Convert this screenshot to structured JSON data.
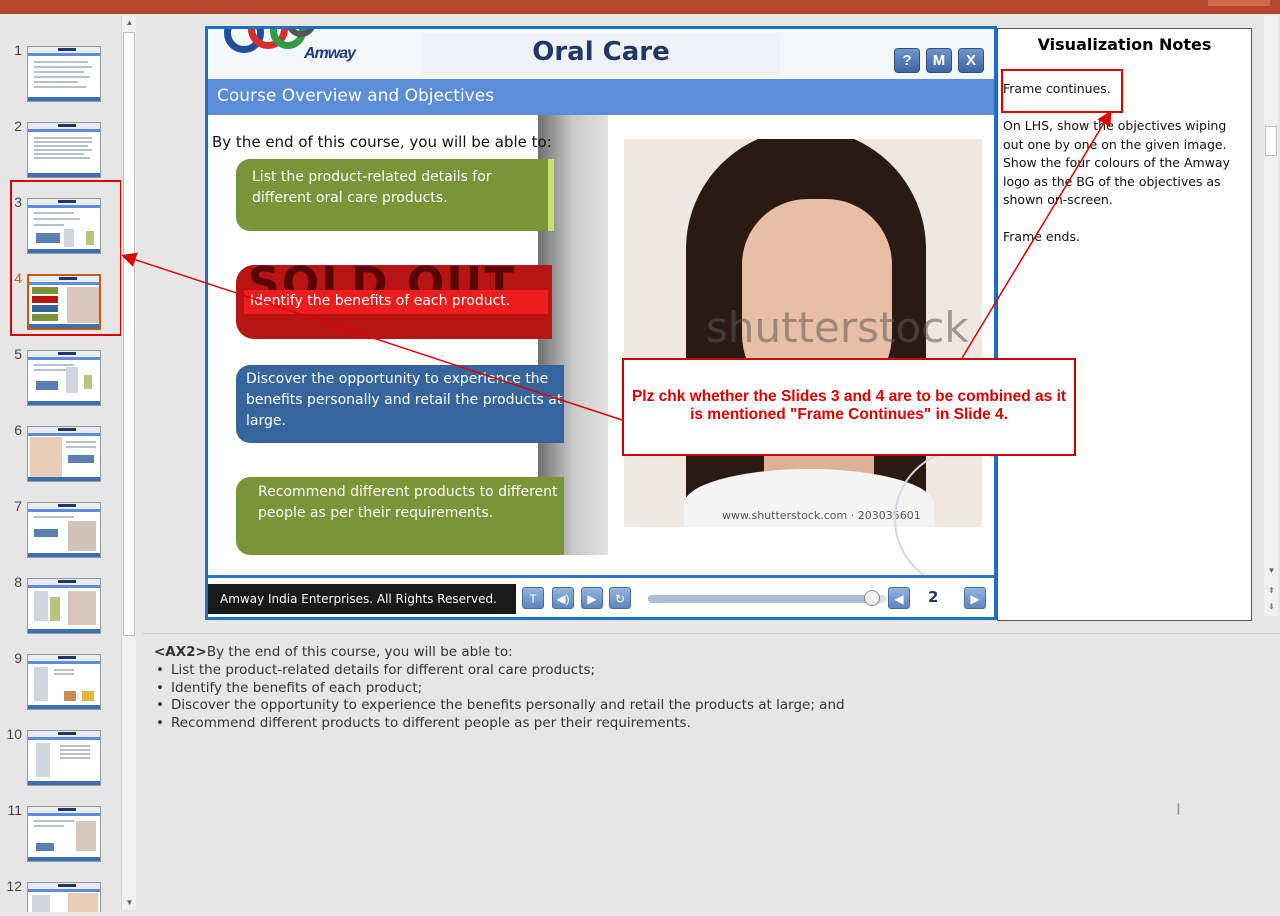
{
  "thumbnails": [
    {
      "num": "1"
    },
    {
      "num": "2"
    },
    {
      "num": "3"
    },
    {
      "num": "4"
    },
    {
      "num": "5"
    },
    {
      "num": "6"
    },
    {
      "num": "7"
    },
    {
      "num": "8"
    },
    {
      "num": "9"
    },
    {
      "num": "10"
    },
    {
      "num": "11"
    },
    {
      "num": "12"
    }
  ],
  "active_slide": "4",
  "slide": {
    "title": "Oral Care",
    "brand": "Amway",
    "header_buttons": [
      "?",
      "M",
      "X"
    ],
    "section_title": "Course Overview and Objectives",
    "intro": "By the end of this course, you will be able to:",
    "objectives": [
      "List the product-related details for different oral care products.",
      "Identify the benefits of each product.",
      "Discover the opportunity to experience the benefits personally and retail the products at large.",
      "Recommend different products to different people as per their requirements."
    ],
    "stamp_text": "SOLD OUT",
    "watermark": "shutterstock",
    "photo_caption": "www.shutterstock.com · 203035601",
    "copyright": "Amway India Enterprises. All Rights Reserved.",
    "footer_buttons": [
      "T",
      "◀)",
      "▶",
      "↻"
    ],
    "page_number": "2",
    "progress": 0.94
  },
  "notes": {
    "title": "Visualization Notes",
    "paragraphs": [
      "Frame continues.",
      "On LHS, show the objectives wiping out one by one on the given image. Show the four colours of the Amway logo as the BG of the objectives as shown on-screen.",
      "Frame ends."
    ]
  },
  "comment": "Plz chk whether the Slides 3 and 4 are to be combined as it is mentioned \"Frame Continues\" in Slide 4.",
  "speaker_notes": {
    "tag": "<AX2>",
    "intro": "By the end of this course, you will be able to:",
    "bullets": [
      "List the product-related details for different oral care products;",
      "Identify the benefits of each product;",
      "Discover the opportunity to experience the benefits personally and retail the products at large; and",
      "Recommend different products to different people as per their requirements."
    ]
  },
  "colors": {
    "accent": "#1f6fc5",
    "comment_red": "#e00000",
    "green": "#7a9538",
    "red": "#b81414",
    "blue": "#36659d"
  }
}
